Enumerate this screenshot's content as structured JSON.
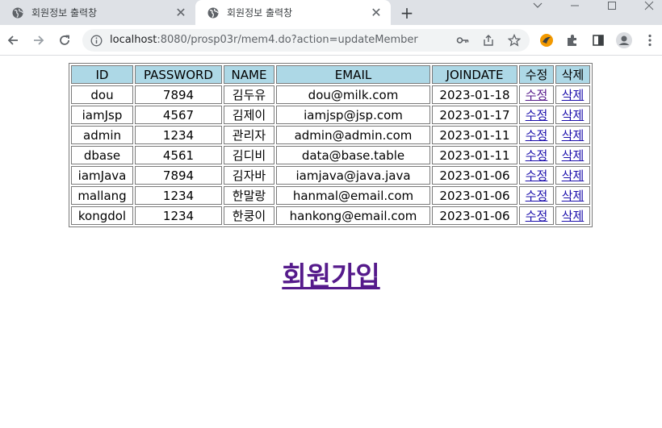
{
  "browser": {
    "tabs": [
      {
        "title": "회원정보 출력창",
        "active": false
      },
      {
        "title": "회원정보 출력창",
        "active": true
      }
    ],
    "url_host": "localhost",
    "url_rest": ":8080/prosp03r/mem4.do?action=updateMember",
    "colors": {
      "tabstrip": "#dee1e6",
      "omnibox": "#f1f3f4"
    }
  },
  "table": {
    "headers": [
      "ID",
      "PASSWORD",
      "NAME",
      "EMAIL",
      "JOINDATE",
      "수정",
      "삭제"
    ],
    "rows": [
      {
        "id": "dou",
        "password": "7894",
        "name": "김두유",
        "email": "dou@milk.com",
        "joindate": "2023-01-18",
        "edit": "수정",
        "delete": "삭제"
      },
      {
        "id": "iamJsp",
        "password": "4567",
        "name": "김제이",
        "email": "iamjsp@jsp.com",
        "joindate": "2023-01-17",
        "edit": "수정",
        "delete": "삭제"
      },
      {
        "id": "admin",
        "password": "1234",
        "name": "관리자",
        "email": "admin@admin.com",
        "joindate": "2023-01-11",
        "edit": "수정",
        "delete": "삭제"
      },
      {
        "id": "dbase",
        "password": "4561",
        "name": "김디비",
        "email": "data@base.table",
        "joindate": "2023-01-11",
        "edit": "수정",
        "delete": "삭제"
      },
      {
        "id": "iamJava",
        "password": "7894",
        "name": "김자바",
        "email": "iamjava@java.java",
        "joindate": "2023-01-06",
        "edit": "수정",
        "delete": "삭제"
      },
      {
        "id": "mallang",
        "password": "1234",
        "name": "한말랑",
        "email": "hanmal@email.com",
        "joindate": "2023-01-06",
        "edit": "수정",
        "delete": "삭제"
      },
      {
        "id": "kongdol",
        "password": "1234",
        "name": "한쿵이",
        "email": "hankong@email.com",
        "joindate": "2023-01-06",
        "edit": "수정",
        "delete": "삭제"
      }
    ],
    "header_bg": "#add8e6"
  },
  "join_link": "회원가입",
  "colors": {
    "link": "#1a0dab",
    "visited_link": "#551a8b"
  }
}
